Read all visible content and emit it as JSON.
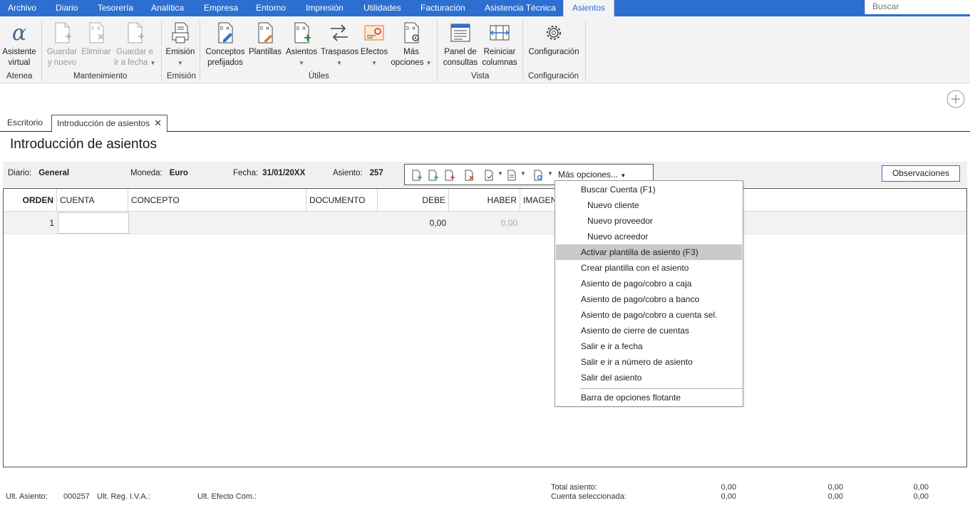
{
  "menu": {
    "items": [
      "Archivo",
      "Diario",
      "Tesorería",
      "Analítica",
      "Empresa",
      "Entorno",
      "Impresión",
      "Utilidades",
      "Facturación",
      "Asistencia Técnica",
      "Asientos"
    ],
    "search_placeholder": "Buscar"
  },
  "ribbon": {
    "atenea": {
      "btn1": [
        "Asistente",
        "virtual"
      ],
      "label": "Atenea"
    },
    "mantenimiento": {
      "guardar_nuevo": [
        "Guardar",
        "y nuevo"
      ],
      "eliminar": "Eliminar",
      "guardar_fecha": [
        "Guardar e",
        "ir a fecha"
      ],
      "label": "Mantenimiento"
    },
    "emision": {
      "btn": "Emisión",
      "label": "Emisión"
    },
    "utiles": {
      "conceptos": [
        "Conceptos",
        "prefijados"
      ],
      "plantillas": "Plantillas",
      "asientos": "Asientos",
      "traspasos": "Traspasos",
      "efectos": "Efectos",
      "mas_opciones": [
        "Más",
        "opciones"
      ],
      "label": "Útiles"
    },
    "vista": {
      "panel": [
        "Panel de",
        "consultas"
      ],
      "reiniciar": [
        "Reiniciar",
        "columnas"
      ],
      "label": "Vista"
    },
    "configuracion": {
      "btn": "Configuración",
      "label": "Configuración"
    }
  },
  "tabs": {
    "escritorio": "Escritorio",
    "introduccion": "Introducción de asientos"
  },
  "page_title": "Introducción de asientos",
  "info": {
    "diario_k": "Diario:",
    "diario_v": "General",
    "moneda_k": "Moneda:",
    "moneda_v": "Euro",
    "fecha_k": "Fecha:",
    "fecha_v": "31/01/20XX",
    "asiento_k": "Asiento:",
    "asiento_v": "257",
    "mas_opciones": "Más opciones...",
    "observaciones": "Observaciones"
  },
  "grid": {
    "headers": {
      "orden": "ORDEN",
      "cuenta": "CUENTA",
      "concepto": "CONCEPTO",
      "documento": "DOCUMENTO",
      "debe": "DEBE",
      "haber": "HABER",
      "imagen": "IMAGEN"
    },
    "rows": [
      {
        "orden": "1",
        "cuenta": "",
        "concepto": "",
        "documento": "",
        "debe": "0,00",
        "haber": "0,00"
      }
    ]
  },
  "dropdown": {
    "items": [
      "Buscar Cuenta (F1)",
      "Nuevo cliente",
      "Nuevo proveedor",
      "Nuevo acreedor",
      "Activar plantilla de asiento (F3)",
      "Crear plantilla con el asiento",
      "Asiento de pago/cobro a caja",
      "Asiento de pago/cobro a banco",
      "Asiento de pago/cobro a cuenta sel.",
      "Asiento de cierre de cuentas",
      "Salir e ir a fecha",
      "Salir e ir a número de asiento",
      "Salir del asiento",
      "Barra de opciones flotante"
    ]
  },
  "footer": {
    "ult_asiento_k": "Ult. Asiento:",
    "ult_asiento_v": "000257",
    "ult_reg_iva": "Ult. Reg. I.V.A.:",
    "ult_efecto": "Ult. Efecto Com.:",
    "total_asiento": "Total asiento:",
    "cuenta_sel": "Cuenta seleccionada:",
    "totals": [
      "0,00",
      "0,00",
      "0,00"
    ],
    "selected": [
      "0,00",
      "0,00",
      "0,00"
    ]
  },
  "colors": {
    "accent": "#2c6fd1",
    "highlight": "#c9c9c9"
  }
}
